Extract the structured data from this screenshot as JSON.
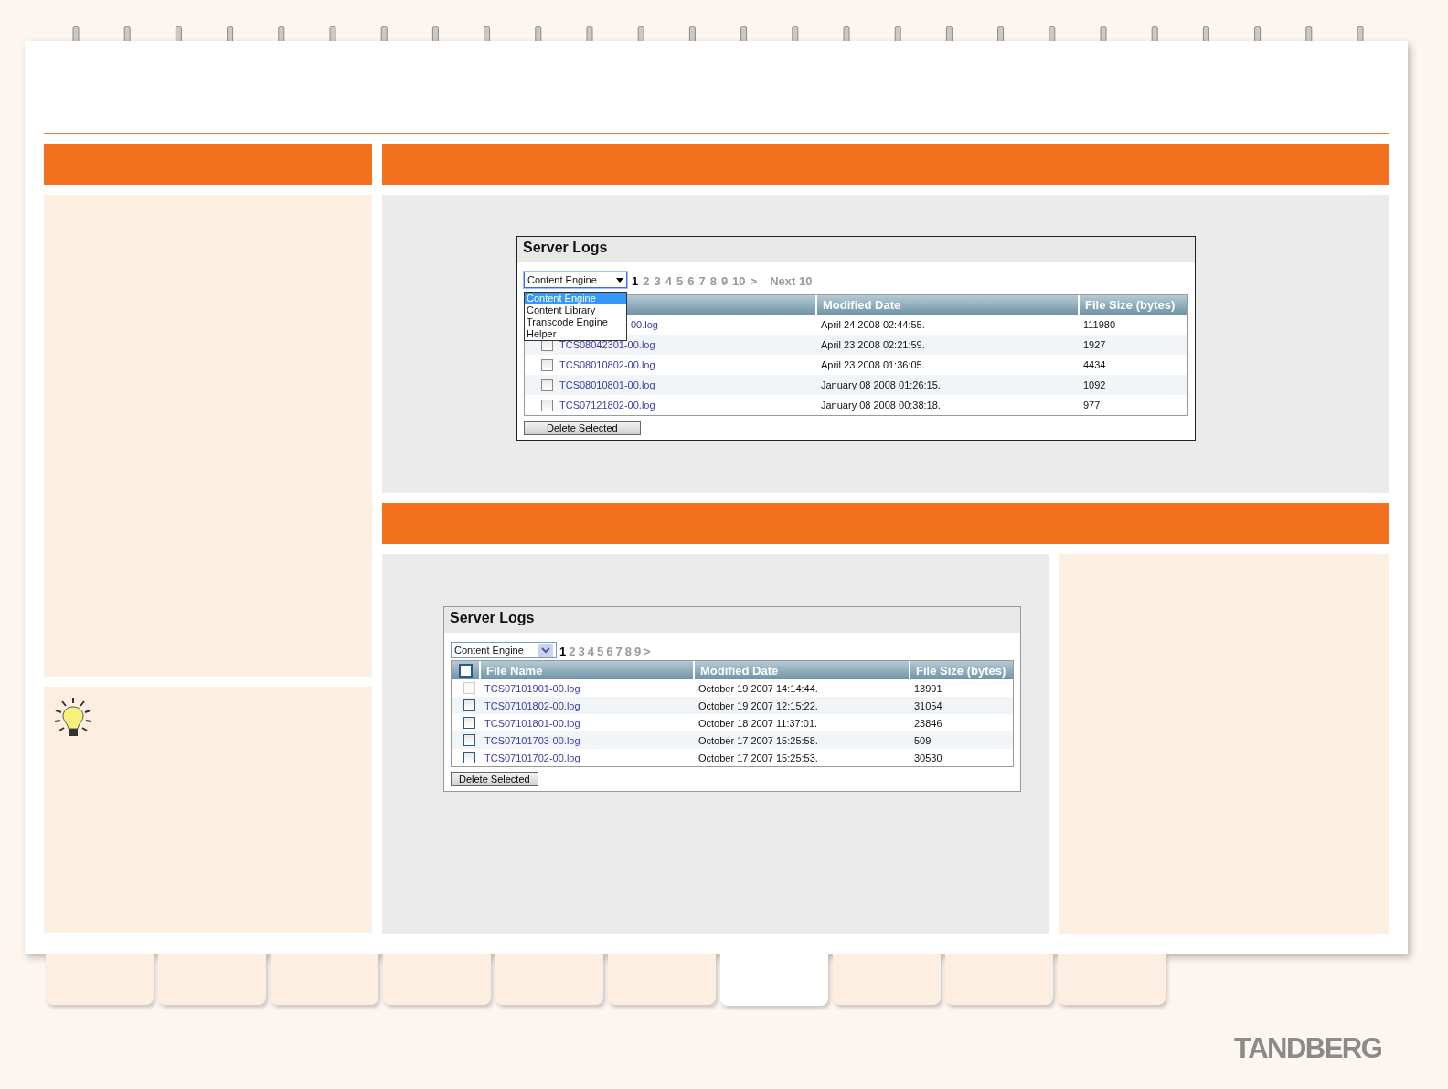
{
  "screenshot_top": {
    "title": "Server Logs",
    "dropdown": {
      "value": "Content Engine",
      "open": true,
      "options": [
        {
          "label": "Content Engine",
          "selected": true
        },
        {
          "label": "Content Library",
          "selected": false
        },
        {
          "label": "Transcode Engine",
          "selected": false
        },
        {
          "label": "Helper",
          "selected": false
        }
      ]
    },
    "pages": [
      {
        "label": "1",
        "selected": true
      },
      {
        "label": "2",
        "selected": false
      },
      {
        "label": "3",
        "selected": false
      },
      {
        "label": "4",
        "selected": false
      },
      {
        "label": "5",
        "selected": false
      },
      {
        "label": "6",
        "selected": false
      },
      {
        "label": "7",
        "selected": false
      },
      {
        "label": "8",
        "selected": false
      },
      {
        "label": "9",
        "selected": false
      },
      {
        "label": "10",
        "selected": false
      },
      {
        "label": ">",
        "selected": false
      },
      {
        "label": "Next 10",
        "selected": false
      }
    ],
    "columns": [
      "",
      "Modified Date",
      "File Size (bytes)"
    ],
    "rows": [
      {
        "file": "00.log",
        "date": "April 24 2008 02:44:55.",
        "size": "111980"
      },
      {
        "checked": false,
        "file": "TCS08042301-00.log",
        "date": "April 23 2008 02:21:59.",
        "size": "1927"
      },
      {
        "checked": false,
        "file": "TCS08010802-00.log",
        "date": "April 23 2008 01:36:05.",
        "size": "4434"
      },
      {
        "checked": false,
        "file": "TCS08010801-00.log",
        "date": "January 08 2008 01:26:15.",
        "size": "1092"
      },
      {
        "checked": false,
        "file": "TCS07121802-00.log",
        "date": "January 08 2008 00:38:18.",
        "size": "977"
      }
    ],
    "button": "Delete Selected"
  },
  "screenshot_bottom": {
    "title": "Server Logs",
    "dropdown": {
      "value": "Content Engine",
      "open": false
    },
    "select_all": {
      "checked": false
    },
    "pages": [
      {
        "label": "1",
        "selected": true
      },
      {
        "label": "2",
        "selected": false
      },
      {
        "label": "3",
        "selected": false
      },
      {
        "label": "4",
        "selected": false
      },
      {
        "label": "5",
        "selected": false
      },
      {
        "label": "6",
        "selected": false
      },
      {
        "label": "7",
        "selected": false
      },
      {
        "label": "8",
        "selected": false
      },
      {
        "label": "9",
        "selected": false
      },
      {
        "label": ">",
        "selected": false
      }
    ],
    "columns": [
      "File Name",
      "Modified Date",
      "File Size (bytes)"
    ],
    "rows": [
      {
        "checked": false,
        "disabled": true,
        "file": "TCS07101901-00.log",
        "date": "October 19 2007 14:14:44.",
        "size": "13991"
      },
      {
        "checked": false,
        "disabled": false,
        "file": "TCS07101802-00.log",
        "date": "October 19 2007 12:15:22.",
        "size": "31054"
      },
      {
        "checked": false,
        "disabled": false,
        "file": "TCS07101801-00.log",
        "date": "October 18 2007 11:37:01.",
        "size": "23846"
      },
      {
        "checked": false,
        "disabled": false,
        "file": "TCS07101703-00.log",
        "date": "October 17 2007 15:25:58.",
        "size": "509"
      },
      {
        "checked": false,
        "disabled": false,
        "file": "TCS07101702-00.log",
        "date": "October 17 2007 15:25:53.",
        "size": "30530"
      }
    ],
    "button": "Delete Selected"
  },
  "nav_tabs": [
    {
      "selected": false
    },
    {
      "selected": false
    },
    {
      "selected": false
    },
    {
      "selected": false
    },
    {
      "selected": false
    },
    {
      "selected": false
    },
    {
      "selected": true
    },
    {
      "selected": false
    },
    {
      "selected": false
    },
    {
      "selected": false
    }
  ],
  "logo": "TANDBERG"
}
